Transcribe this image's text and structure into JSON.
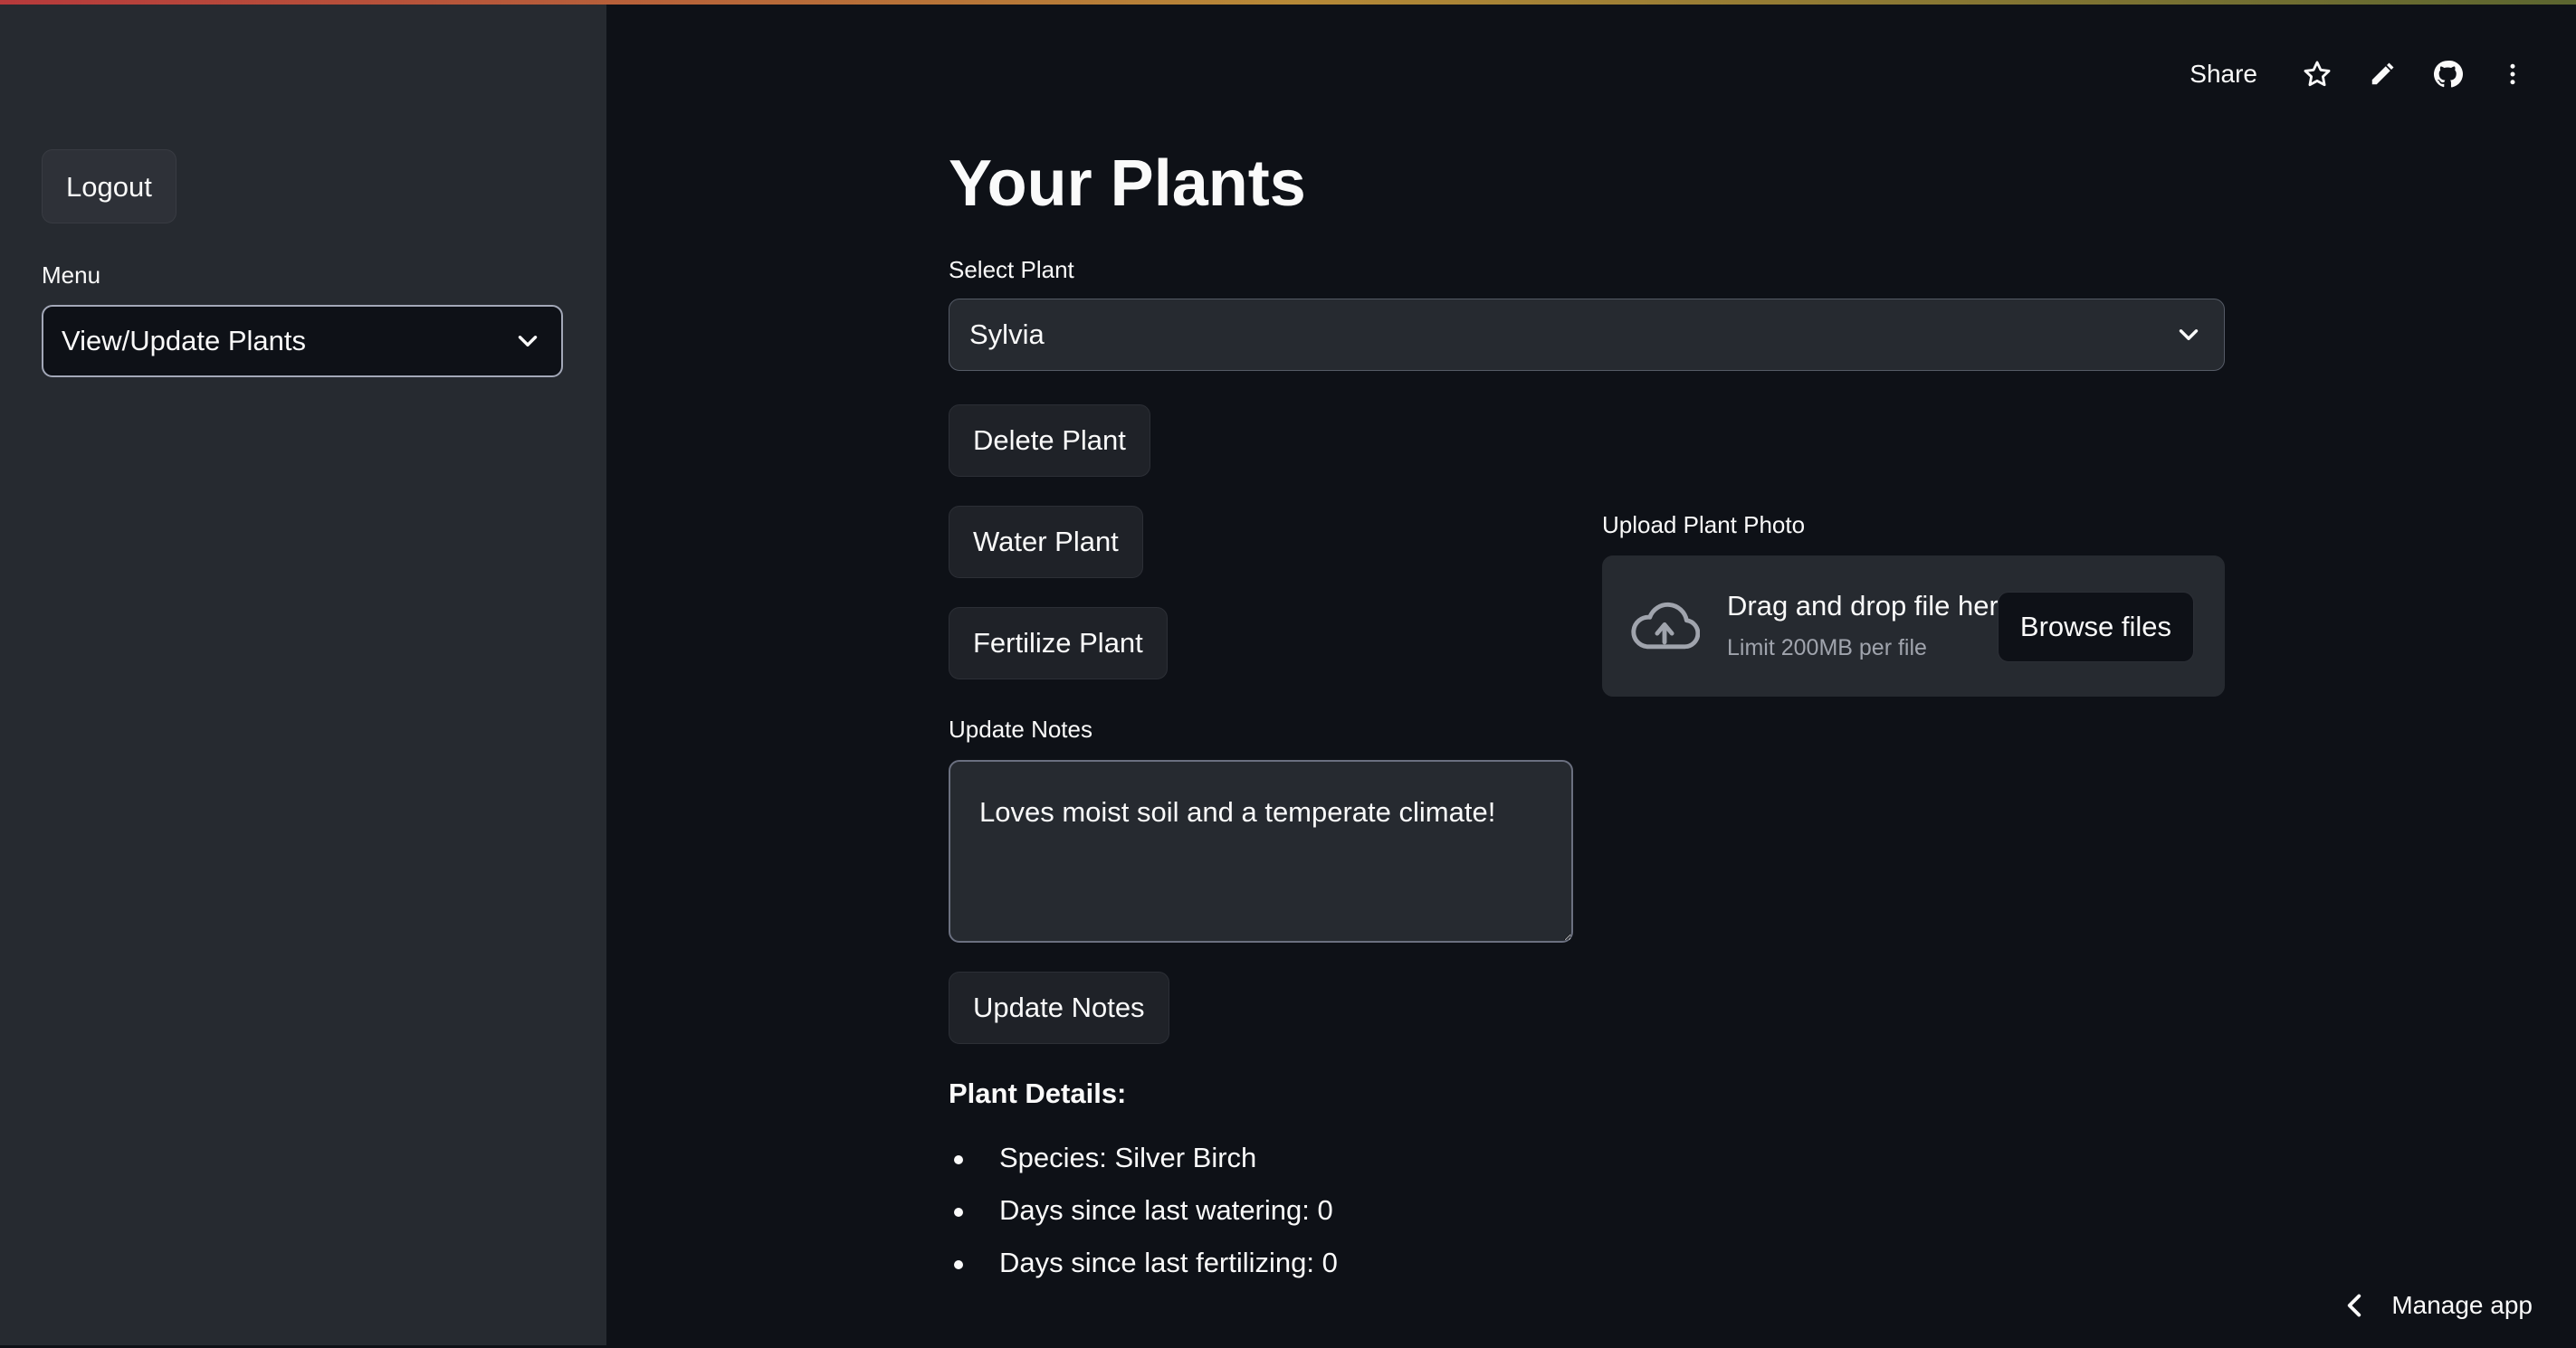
{
  "sidebar": {
    "logout_label": "Logout",
    "menu_label": "Menu",
    "menu_selected": "View/Update Plants"
  },
  "toolbar": {
    "share_label": "Share",
    "icons": [
      "star-icon",
      "pencil-icon",
      "github-icon",
      "more-vertical-icon"
    ]
  },
  "main": {
    "title": "Your Plants",
    "select_plant_label": "Select Plant",
    "select_plant_value": "Sylvia",
    "delete_label": "Delete Plant",
    "water_label": "Water Plant",
    "fertilize_label": "Fertilize Plant",
    "update_notes_label": "Update Notes",
    "notes_value": "Loves moist soil and a temperate climate!",
    "update_notes_button": "Update Notes",
    "details_heading": "Plant Details:",
    "details": [
      "Species: Silver Birch",
      "Days since last watering: 0",
      "Days since last fertilizing: 0"
    ]
  },
  "uploader": {
    "label": "Upload Plant Photo",
    "drag_text": "Drag and drop file here",
    "limit_text": "Limit 200MB per file",
    "browse_label": "Browse files"
  },
  "footer": {
    "manage_label": "Manage app"
  },
  "colors": {
    "background": "#0e1117",
    "sidebar": "#262a30",
    "text": "#fafafa"
  }
}
